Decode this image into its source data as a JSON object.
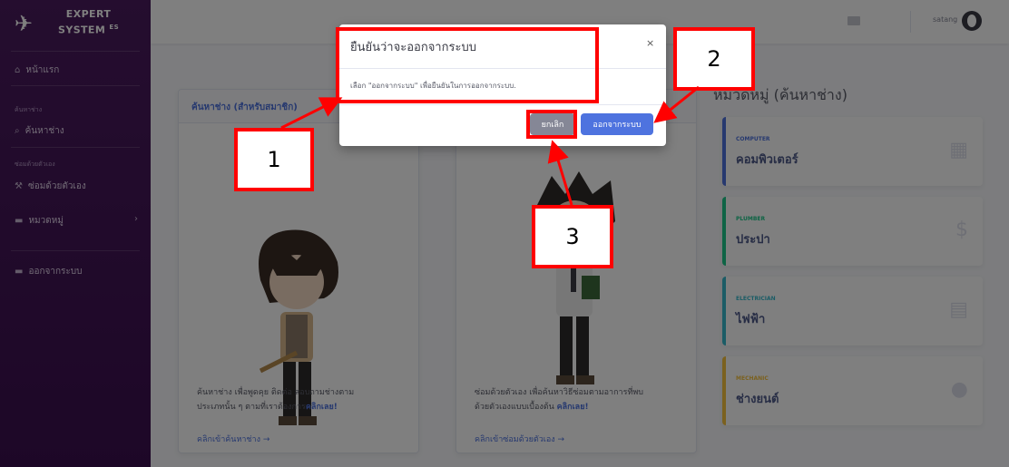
{
  "sidebar": {
    "brand_line1": "EXPERT",
    "brand_line2": "SYSTEM",
    "brand_sup": "ES",
    "items": [
      {
        "label": "หน้าแรก",
        "icon": "home-icon"
      },
      {
        "heading": "ค้นหาช่าง"
      },
      {
        "label": "ค้นหาช่าง",
        "icon": "search-icon"
      },
      {
        "heading": "ซ่อมด้วยตัวเอง"
      },
      {
        "label": "ซ่อมด้วยตัวเอง",
        "icon": "wrench-icon"
      },
      {
        "label": "หมวดหมู่",
        "icon": "folder-icon"
      },
      {
        "label": "ออกจากระบบ",
        "icon": "logout-icon"
      }
    ]
  },
  "topbar": {
    "user": "satang"
  },
  "cards": [
    {
      "title": "ค้นหาช่าง (สำหรับสมาชิก)",
      "desc1": "ค้นหาช่าง เพื่อพูดคุย ติดต่อ สอบถามช่างตาม",
      "desc2_pre": "ประเภทนั้น ๆ ตามที่เราต้องการ",
      "desc2_em": "คลิกเลย!",
      "link": "คลิกเข้าค้นหาช่าง →"
    },
    {
      "title": "",
      "desc1": "ซ่อมด้วยตัวเอง เพื่อค้นหาวิธีซ่อมตามอาการที่พบ",
      "desc2_pre": "ด้วยตัวเองแบบเบื้องต้น ",
      "desc2_em": "คลิกเลย!",
      "link": "คลิกเข้าซ่อมด้วยตัวเอง →"
    }
  ],
  "categories_title": "หมวดหมู่ (ค้นหาช่าง)",
  "categories": [
    {
      "small": "COMPUTER",
      "big": "คอมพิวเตอร์",
      "color": "#4e73df",
      "icon": "calendar-icon"
    },
    {
      "small": "PLUMBER",
      "big": "ประปา",
      "color": "#1cc88a",
      "icon": "dollar-icon"
    },
    {
      "small": "ELECTRICIAN",
      "big": "ไฟฟ้า",
      "color": "#36b9cc",
      "icon": "clipboard-icon"
    },
    {
      "small": "MECHANIC",
      "big": "ช่างยนต์",
      "color": "#f6c23e",
      "icon": "chat-icon"
    }
  ],
  "modal": {
    "title": "ยืนยันว่าจะออกจากระบบ",
    "close": "×",
    "body": "เลือก \"ออกจากระบบ\" เพื่อยืนยันในการออกจากระบบ.",
    "cancel": "ยกเลิก",
    "confirm": "ออกจากระบบ"
  },
  "annotations": [
    "1",
    "2",
    "3"
  ],
  "colors": {
    "annotation": "#ff0000",
    "primary": "#4e73df",
    "sidebar": "#3b0f4f"
  }
}
